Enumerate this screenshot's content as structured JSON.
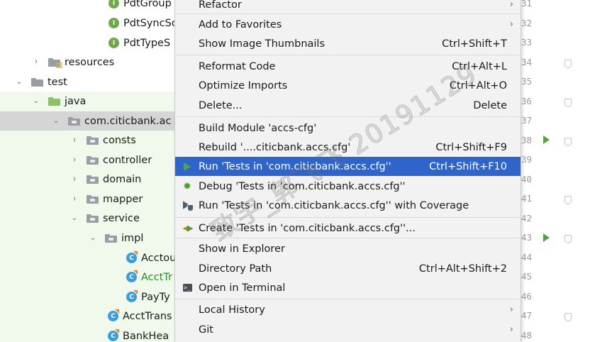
{
  "tree": {
    "rows": [
      {
        "kind": "interface",
        "label": "PdtGroup",
        "arrow": ""
      },
      {
        "kind": "interface",
        "label": "PdtSyncSc",
        "arrow": ""
      },
      {
        "kind": "interface",
        "label": "PdtTypeS",
        "arrow": ""
      },
      {
        "kind": "resources",
        "label": "resources",
        "arrow": "›"
      },
      {
        "kind": "folder",
        "label": "test",
        "arrow": "⌄"
      },
      {
        "kind": "srcfolder",
        "label": "java",
        "arrow": "⌄"
      },
      {
        "kind": "package",
        "label": "com.citicbank.ac",
        "arrow": "⌄"
      },
      {
        "kind": "package",
        "label": "consts",
        "arrow": "›"
      },
      {
        "kind": "package",
        "label": "controller",
        "arrow": "›"
      },
      {
        "kind": "package",
        "label": "domain",
        "arrow": "›"
      },
      {
        "kind": "package",
        "label": "mapper",
        "arrow": "›"
      },
      {
        "kind": "package",
        "label": "service",
        "arrow": "⌄"
      },
      {
        "kind": "package",
        "label": "impl",
        "arrow": "⌄"
      },
      {
        "kind": "class",
        "label": "Acctou",
        "arrow": ""
      },
      {
        "kind": "class",
        "label": "AcctTr",
        "arrow": ""
      },
      {
        "kind": "class",
        "label": "PayTy",
        "arrow": ""
      },
      {
        "kind": "class",
        "label": "AcctTrans",
        "arrow": ""
      },
      {
        "kind": "class",
        "label": "BankHea",
        "arrow": ""
      }
    ]
  },
  "menu": {
    "refactor": {
      "label": "Refactor",
      "submenu": "›"
    },
    "add_to_favorites": {
      "label": "Add to Favorites",
      "submenu": "›"
    },
    "show_image_thumbnails": {
      "label": "Show Image Thumbnails",
      "shortcut": "Ctrl+Shift+T"
    },
    "reformat_code": {
      "label": "Reformat Code",
      "shortcut": "Ctrl+Alt+L"
    },
    "optimize_imports": {
      "label": "Optimize Imports",
      "shortcut": "Ctrl+Alt+O"
    },
    "delete": {
      "label": "Delete...",
      "shortcut": "Delete"
    },
    "build_module": {
      "label": "Build Module 'accs-cfg'"
    },
    "rebuild": {
      "label": "Rebuild '....citicbank.accs.cfg'",
      "shortcut": "Ctrl+Shift+F9"
    },
    "run_tests": {
      "label": "Run 'Tests in 'com.citicbank.accs.cfg''",
      "shortcut": "Ctrl+Shift+F10"
    },
    "debug_tests": {
      "label": "Debug 'Tests in 'com.citicbank.accs.cfg''"
    },
    "run_coverage": {
      "label": "Run 'Tests in 'com.citicbank.accs.cfg'' with Coverage"
    },
    "create_tests": {
      "label": "Create 'Tests in 'com.citicbank.accs.cfg''..."
    },
    "show_in_explorer": {
      "label": "Show in Explorer"
    },
    "directory_path": {
      "label": "Directory Path",
      "shortcut": "Ctrl+Alt+Shift+2"
    },
    "open_in_terminal": {
      "label": "Open in Terminal"
    },
    "local_history": {
      "label": "Local History",
      "submenu": "›"
    },
    "git": {
      "label": "Git",
      "submenu": "›"
    }
  },
  "gutter": {
    "line_numbers": [
      "31",
      "32",
      "33",
      "34",
      "35",
      "36",
      "37",
      "38",
      "39",
      "40",
      "41",
      "42",
      "43",
      "44",
      "45",
      "46",
      "47",
      "48"
    ]
  },
  "watermark": {
    "text": "致宇_郭飞飞 20191129"
  },
  "colors": {
    "selection": "#2f65ca",
    "run_green": "#52a345",
    "test_bg": "#f1f8ec"
  }
}
